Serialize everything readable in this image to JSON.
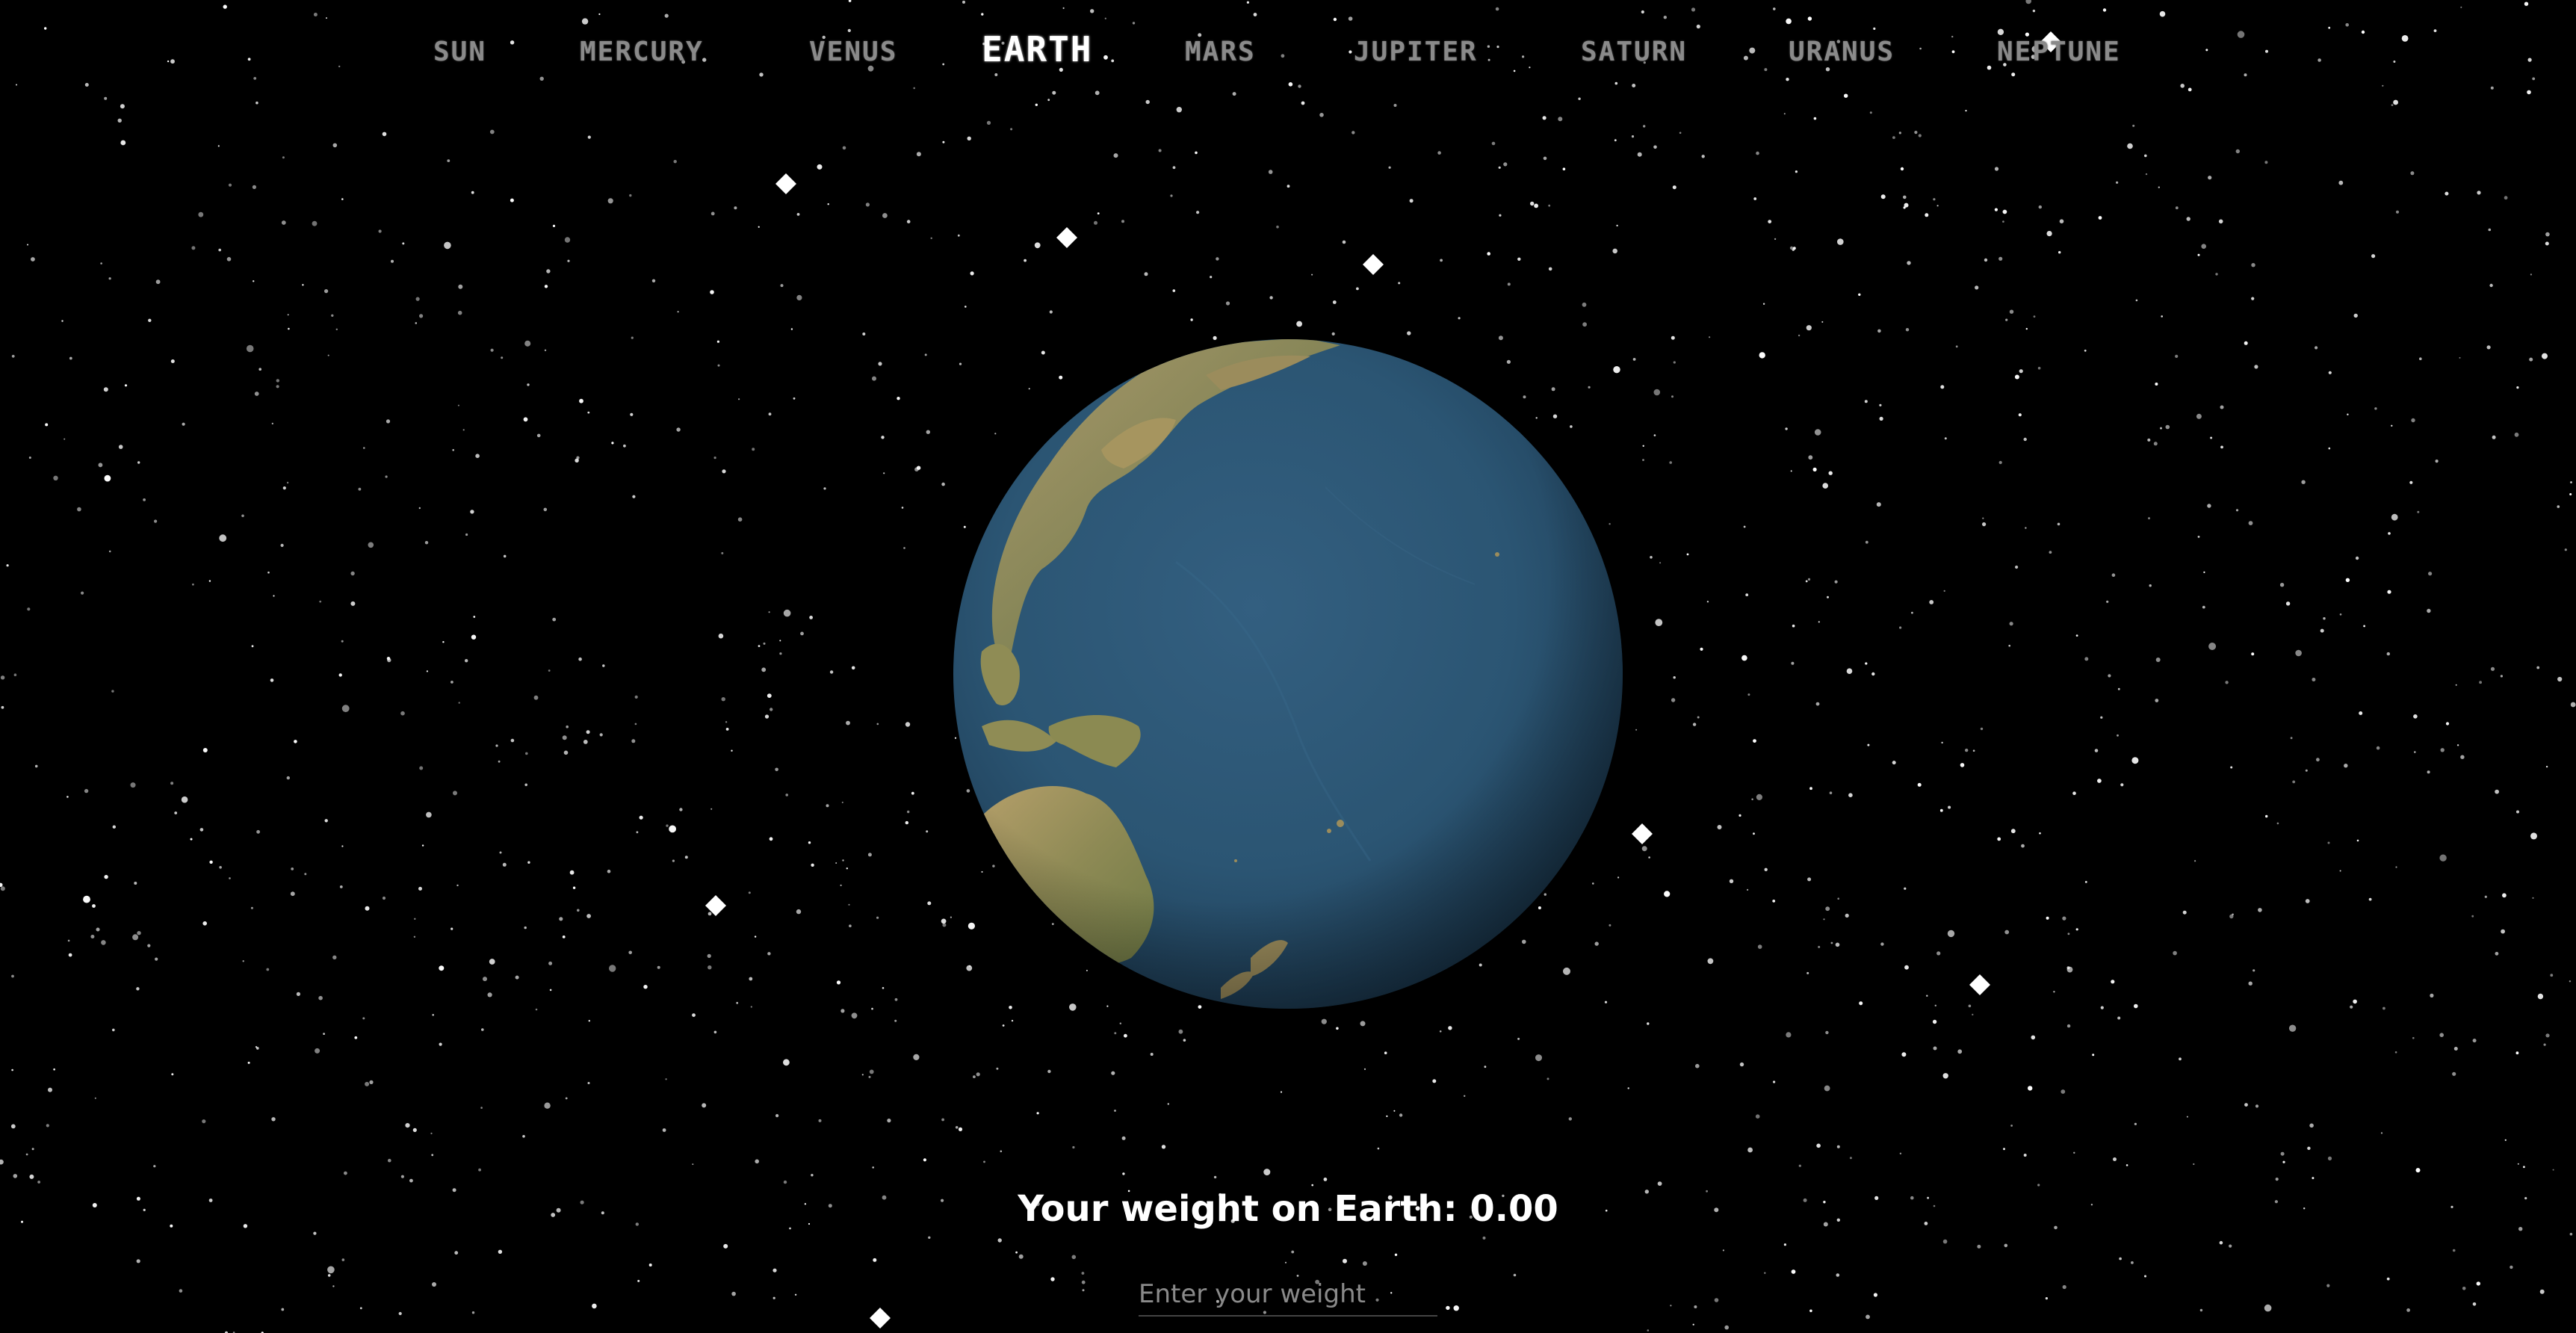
{
  "nav": {
    "items": [
      {
        "id": "sun",
        "label": "SUN"
      },
      {
        "id": "mercury",
        "label": "MERCURY"
      },
      {
        "id": "venus",
        "label": "VENUS"
      },
      {
        "id": "earth",
        "label": "EARTH"
      },
      {
        "id": "mars",
        "label": "MARS"
      },
      {
        "id": "jupiter",
        "label": "JUPITER"
      },
      {
        "id": "saturn",
        "label": "SATURN"
      },
      {
        "id": "uranus",
        "label": "URANUS"
      },
      {
        "id": "neptune",
        "label": "NEPTUNE"
      }
    ],
    "active": "earth"
  },
  "weight": {
    "label": "Your weight on Earth: 0.00",
    "input_value": "",
    "input_placeholder": "Enter your weight"
  },
  "colors": {
    "background": "#000000",
    "nav_inactive": "#8a8a8a",
    "nav_active": "#ffffff",
    "ocean": "#2b5573",
    "land": "#9a8a5a"
  }
}
